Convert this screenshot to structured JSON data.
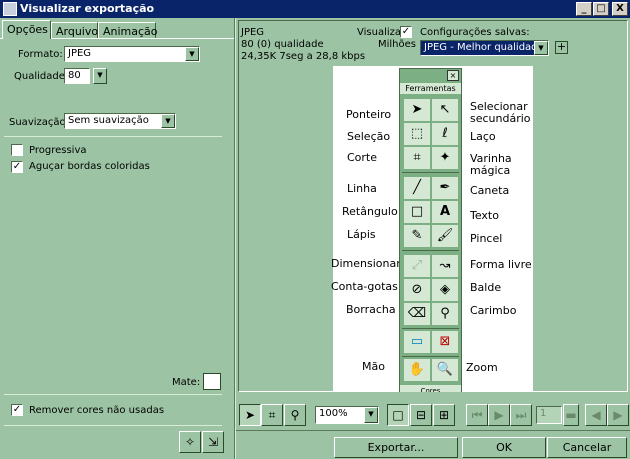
{
  "window": {
    "title": "Visualizar exportação",
    "minimize": "_",
    "maximize": "□",
    "close": "X"
  },
  "tabs": [
    "Opções",
    "Arquivo",
    "Animação"
  ],
  "options": {
    "format_label": "Formato:",
    "format_value": "JPEG",
    "quality_label": "Qualidade:",
    "quality_value": "80",
    "smoothing_label": "Suavização:",
    "smoothing_value": "Sem suavização",
    "progressive_label": "Progressiva",
    "progressive_checked": false,
    "sharpen_label": "Aguçar bordas coloridas",
    "sharpen_checked": true,
    "matte_label": "Mate:",
    "remove_unused_label": "Remover cores não usadas",
    "remove_unused_checked": true
  },
  "preview_info": {
    "format": "JPEG",
    "quality": "80 (0) qualidade",
    "size_time": "24,35K  7seg a 28,8 kbps",
    "show_label": "Visualizar",
    "colors_label": "Milhões",
    "saved_settings_label": "Configurações salvas:",
    "saved_settings_value": "JPEG - Melhor qualidade",
    "add_button": "+"
  },
  "tool_palette": {
    "title": "Ferramentas",
    "close": "×",
    "left_labels": [
      "Ponteiro",
      "Seleção",
      "Corte",
      "Linha",
      "Retângulo",
      "Lápis",
      "Dimensionar",
      "Conta-gotas",
      "Borracha",
      "Mão"
    ],
    "right_labels": [
      "Selecionar secundário",
      "Laço",
      "Varinha mágica",
      "Caneta",
      "Texto",
      "Pincel",
      "Forma livre",
      "Balde",
      "Carimbo",
      "Zoom"
    ],
    "footer": "Cores"
  },
  "bottom": {
    "zoom_value": "100%",
    "frame_value": "1",
    "export_button": "Exportar...",
    "ok_button": "OK",
    "cancel_button": "Cancelar"
  },
  "colors": {
    "titlebar": "#0a246a",
    "panel": "#9cc4a4",
    "selection": "#0a246a"
  }
}
